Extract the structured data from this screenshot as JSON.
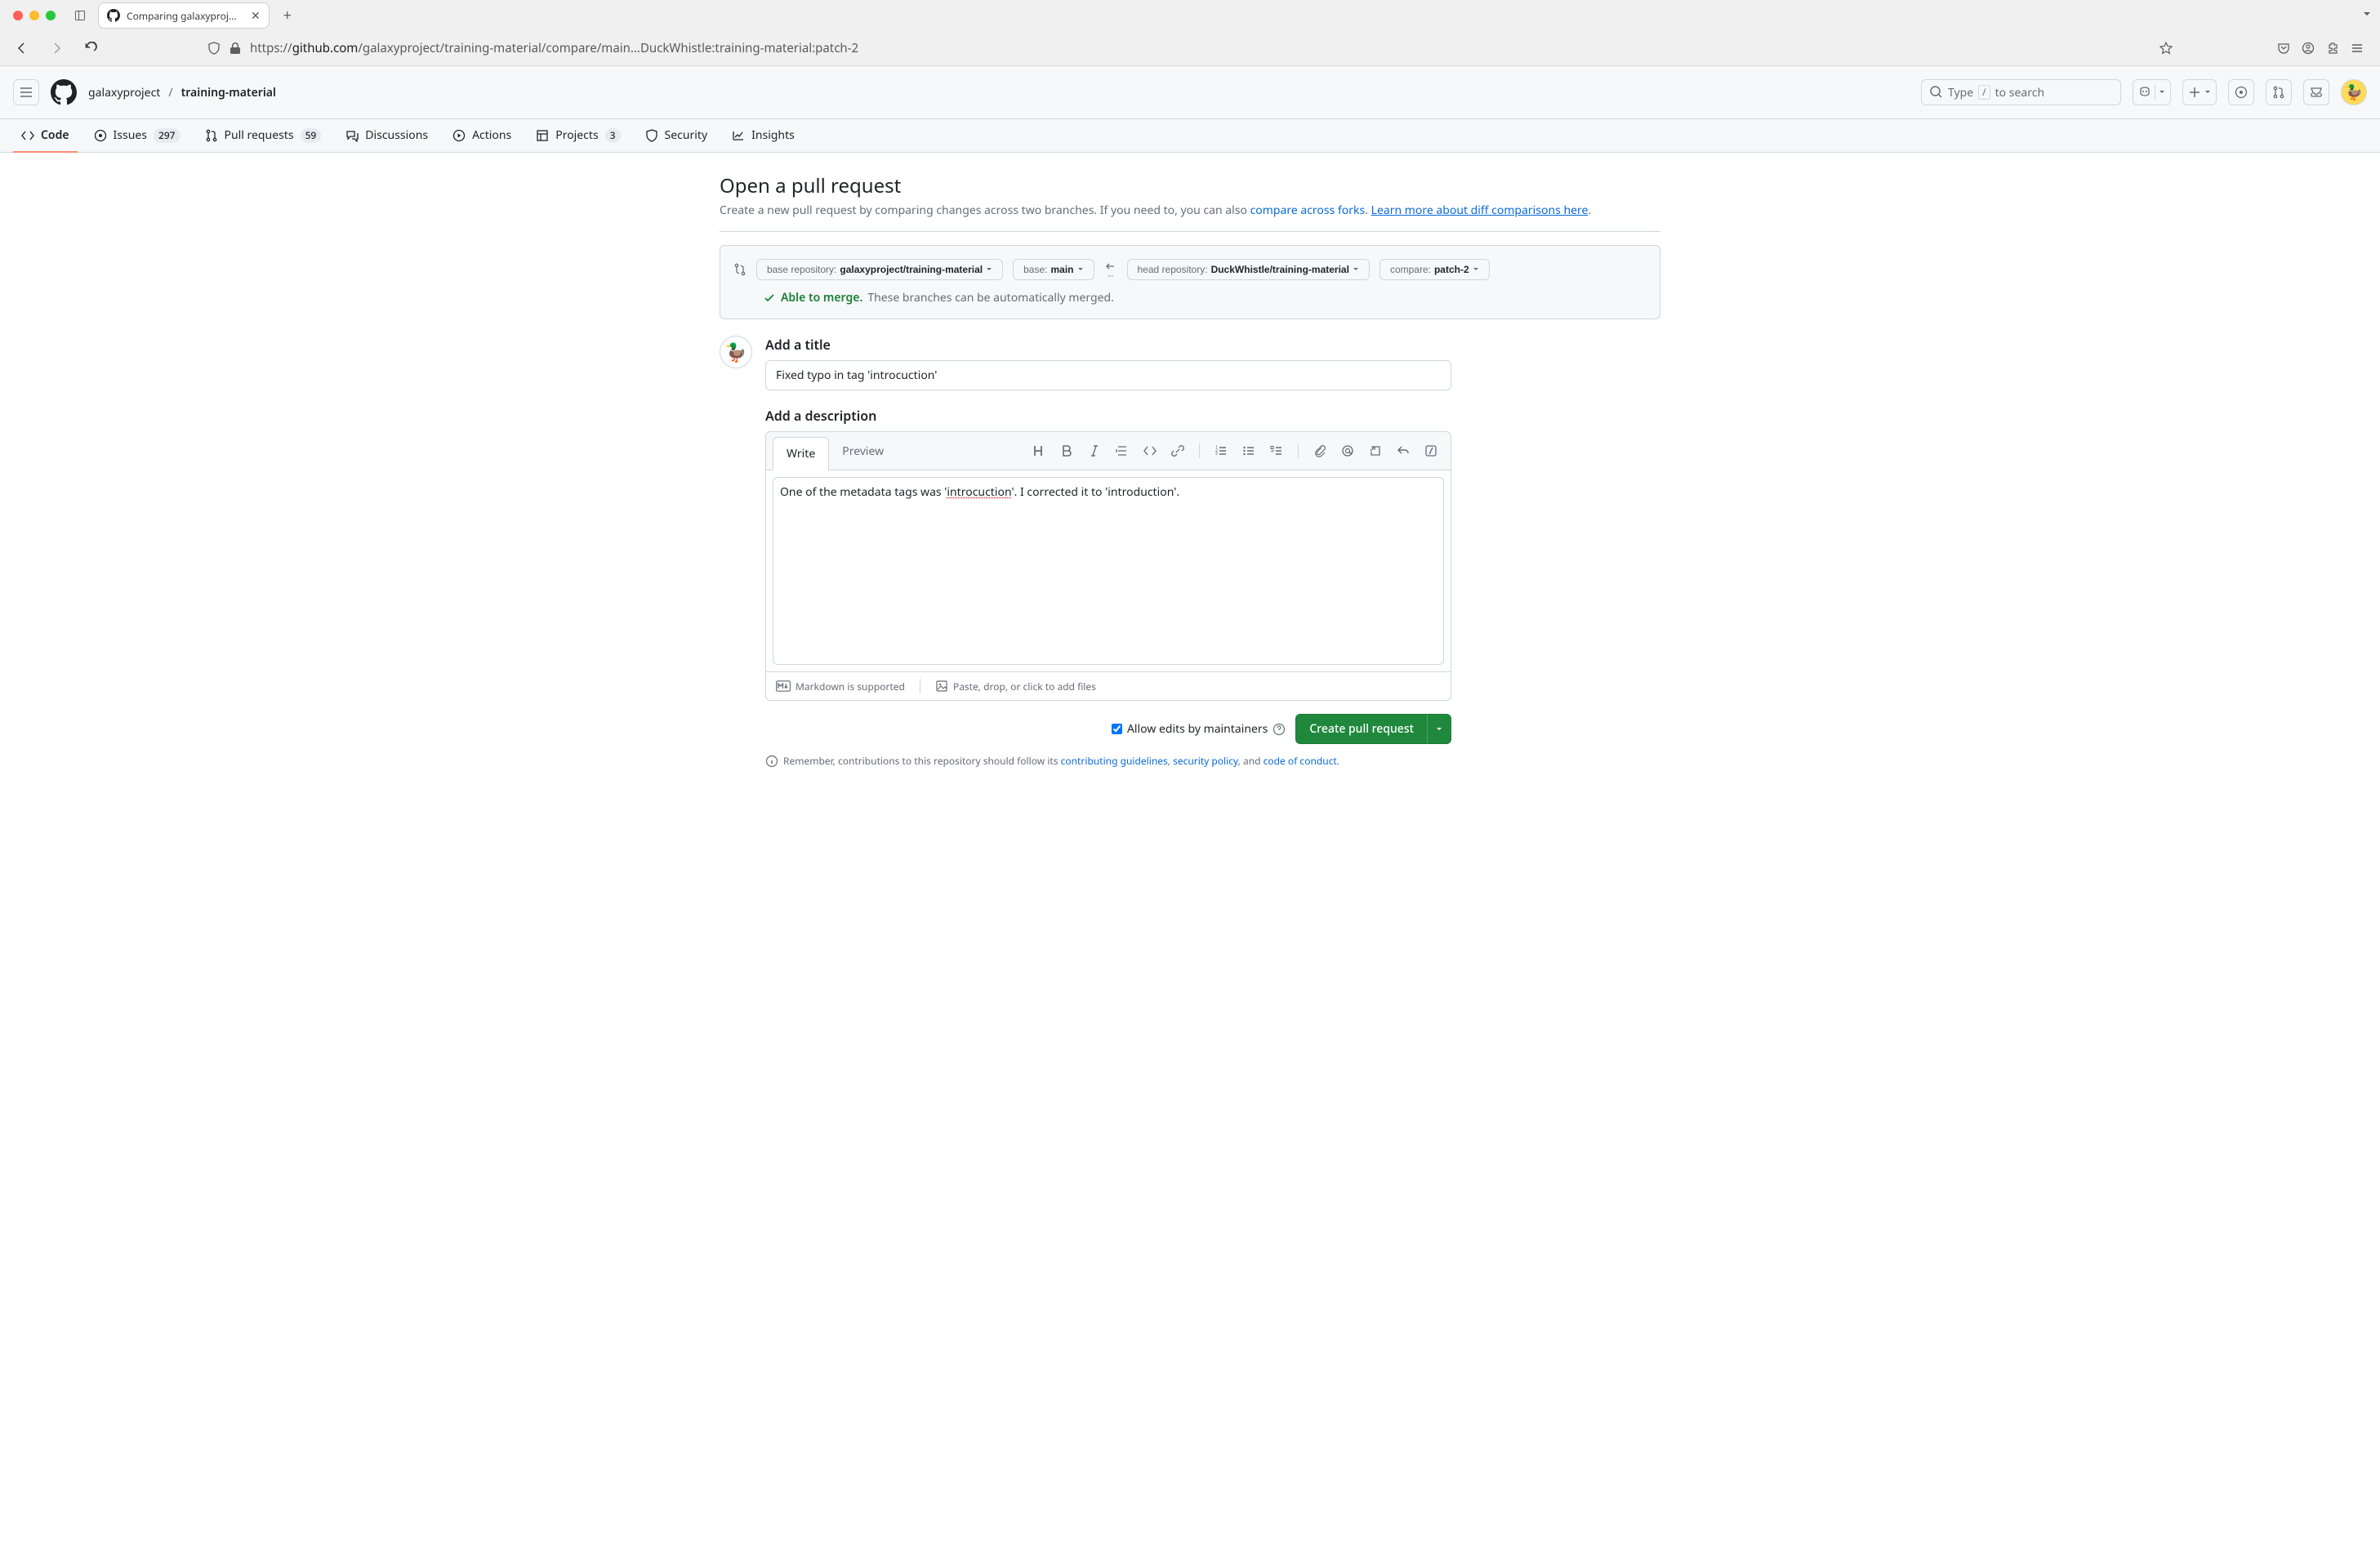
{
  "browser": {
    "tab_title": "Comparing galaxyproject:main...",
    "url_prefix": "https://",
    "url_domain": "github.com",
    "url_path": "/galaxyproject/training-material/compare/main...DuckWhistle:training-material:patch-2"
  },
  "header": {
    "repo_owner": "galaxyproject",
    "repo_name": "training-material",
    "search_placeholder_pre": "Type",
    "search_key": "/",
    "search_placeholder_post": "to search"
  },
  "repo_nav": {
    "code": "Code",
    "issues": "Issues",
    "issues_count": "297",
    "pulls": "Pull requests",
    "pulls_count": "59",
    "discussions": "Discussions",
    "actions": "Actions",
    "projects": "Projects",
    "projects_count": "3",
    "security": "Security",
    "insights": "Insights"
  },
  "page": {
    "title": "Open a pull request",
    "subtitle_text": "Create a new pull request by comparing changes across two branches. If you need to, you can also ",
    "subtitle_link1": "compare across forks",
    "subtitle_mid": ". ",
    "subtitle_link2": "Learn more about diff comparisons here",
    "subtitle_end": "."
  },
  "compare": {
    "base_repo_label": "base repository: ",
    "base_repo": "galaxyproject/training-material",
    "base_label": "base: ",
    "base_branch": "main",
    "head_repo_label": "head repository: ",
    "head_repo": "DuckWhistle/training-material",
    "compare_label": "compare: ",
    "compare_branch": "patch-2",
    "merge_ok": "Able to merge.",
    "merge_detail": "These branches can be automatically merged."
  },
  "form": {
    "title_label": "Add a title",
    "title_value": "Fixed typo in tag 'introcuction'",
    "desc_label": "Add a description",
    "tab_write": "Write",
    "tab_preview": "Preview",
    "description_pre": "One of the metadata tags was '",
    "description_typo": "introcuction",
    "description_post": "'. I corrected it to 'introduction'.",
    "description_full": "One of the metadata tags was 'introcuction'. I corrected it to 'introduction'.",
    "markdown_supported": "Markdown is supported",
    "paste_drop": "Paste, drop, or click to add files",
    "allow_edits": "Allow edits by maintainers",
    "create_pr": "Create pull request"
  },
  "notice": {
    "text_pre": "Remember, contributions to this repository should follow its ",
    "link1": "contributing guidelines",
    "sep1": ", ",
    "link2": "security policy",
    "sep2": ", and ",
    "link3": "code of conduct",
    "end": "."
  }
}
